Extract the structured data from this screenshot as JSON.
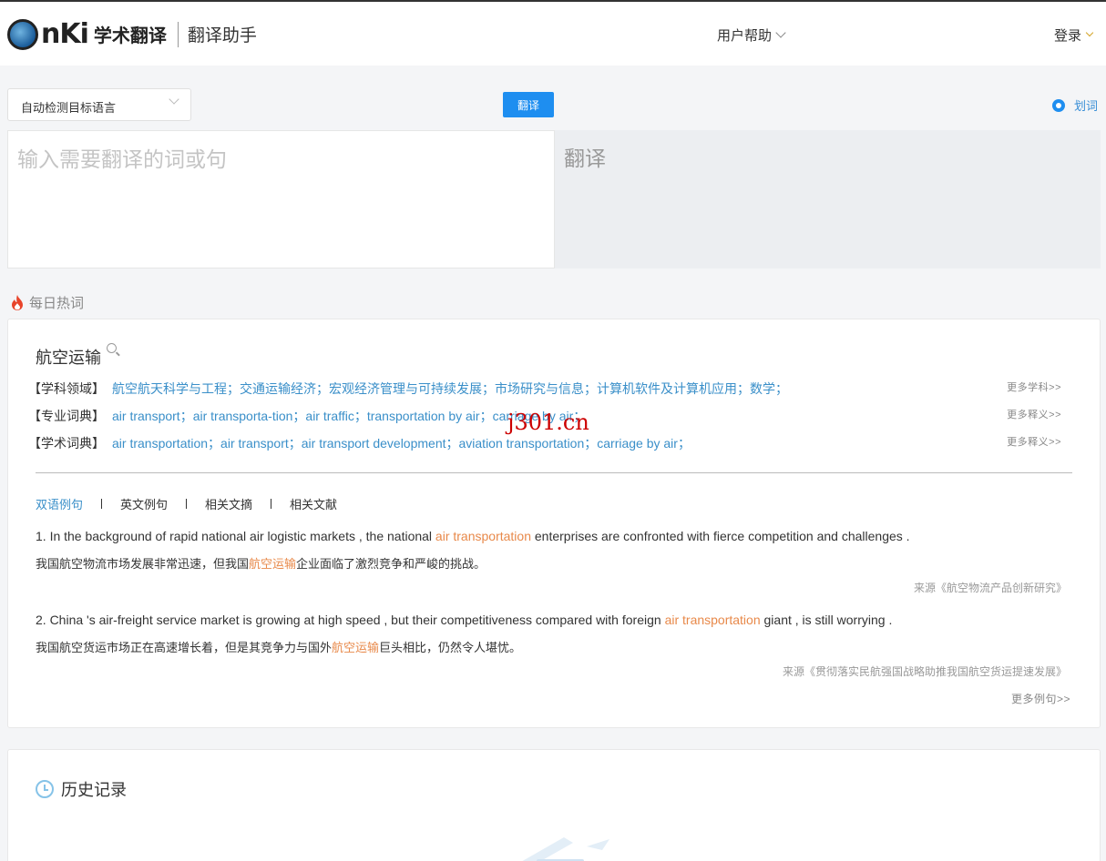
{
  "header": {
    "logo_text": "nKi",
    "logo_title": "学术翻译",
    "subtitle": "翻译助手",
    "help_label": "用户帮助",
    "login_label": "登录"
  },
  "toolbar": {
    "language_select": "自动检测目标语言",
    "translate_button": "翻译",
    "huaci_label": "划词"
  },
  "translator": {
    "input_placeholder": "输入需要翻译的词或句",
    "output_placeholder": "翻译"
  },
  "hot": {
    "section_title": "每日热词",
    "word": "航空运输",
    "rows": [
      {
        "label": "【学科领域】",
        "text": "航空航天科学与工程；交通运输经济；宏观经济管理与可持续发展；市场研究与信息；计算机软件及计算机应用；数学；",
        "more": "更多学科>>"
      },
      {
        "label": "【专业词典】",
        "text": "air transport；air transporta-tion；air traffic；transportation by air；carriage by air；",
        "more": "更多释义>>"
      },
      {
        "label": "【学术词典】",
        "text": "air transportation；air transport；air transport development；aviation transportation；carriage by air；",
        "more": "更多释义>>"
      }
    ],
    "tabs": [
      "双语例句",
      "英文例句",
      "相关文摘",
      "相关文献"
    ],
    "examples": [
      {
        "en_pre": "1. In the background of rapid national air logistic markets , the national ",
        "en_hl": "air transportation",
        "en_post": " enterprises are confronted with fierce competition and challenges .",
        "zh_pre": "我国航空物流市场发展非常迅速，但我国",
        "zh_hl": "航空运输",
        "zh_post": "企业面临了激烈竞争和严峻的挑战。",
        "source": "来源《航空物流产品创新研究》"
      },
      {
        "en_pre": "2. China 's air-freight service market is growing at high speed , but their competitiveness compared with foreign ",
        "en_hl": "air transportation",
        "en_post": " giant , is still worrying .",
        "zh_pre": "我国航空货运市场正在高速增长着，但是其竞争力与国外",
        "zh_hl": "航空运输",
        "zh_post": "巨头相比，仍然令人堪忧。",
        "source": "来源《贯彻落实民航强国战略助推我国航空货运提速发展》"
      }
    ],
    "more_examples": "更多例句>>"
  },
  "history": {
    "title": "历史记录"
  },
  "watermark": "j301.cn",
  "colors": {
    "accent": "#1e8ef0",
    "link": "#3a8fc9",
    "highlight": "#e8894a"
  }
}
